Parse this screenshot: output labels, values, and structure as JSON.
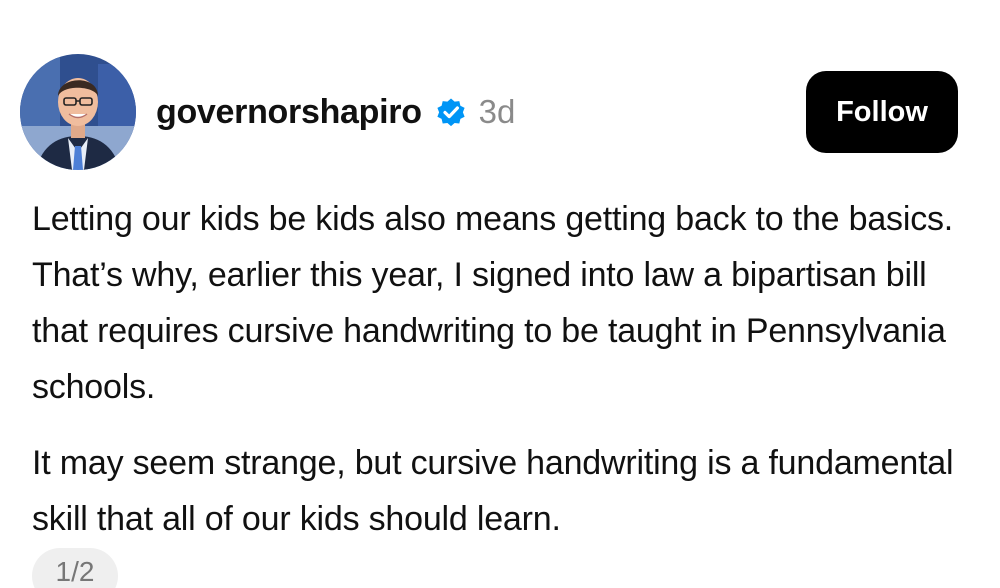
{
  "post": {
    "author": {
      "username": "governorshapiro",
      "verified": true,
      "avatar": "profile-photo"
    },
    "timestamp": "3d",
    "follow_label": "Follow",
    "caption_paragraphs": [
      "Letting our kids be kids also means getting back to the basics. That’s why, earlier this year, I signed into law a bipartisan bill that requires cursive handwriting to be taught in Pennsylvania schools.",
      "It may seem strange, but cursive handwriting is a fundamental skill that all of our kids should learn."
    ],
    "page_indicator": "1/2"
  },
  "colors": {
    "verified_badge": "#0095f6",
    "follow_button_bg": "#000000",
    "follow_button_text": "#ffffff",
    "timestamp": "#8a8a8a",
    "page_pill_bg": "#efefef"
  },
  "icons": {
    "verified": "verified-badge-icon"
  }
}
